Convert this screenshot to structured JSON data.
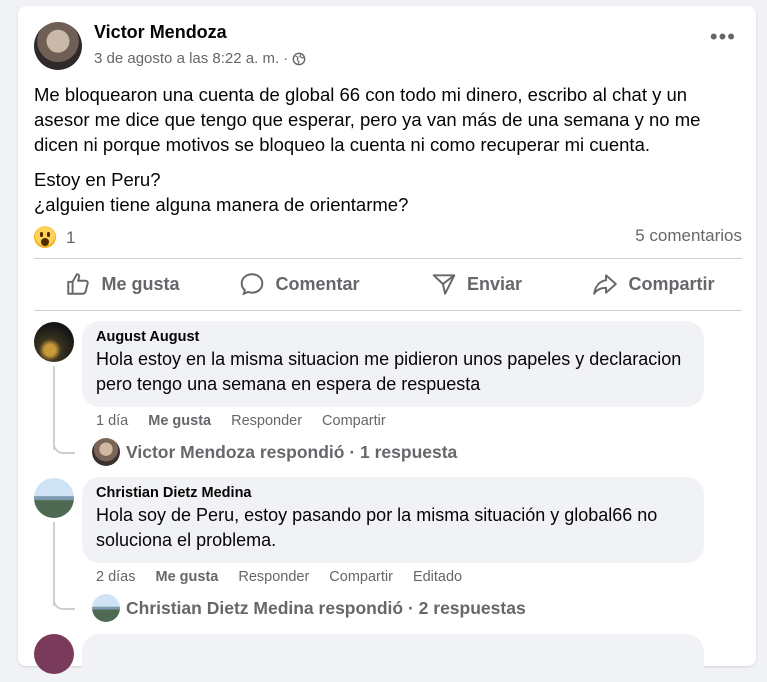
{
  "post": {
    "author": "Victor Mendoza",
    "timestamp": "3 de agosto a las 8:22 a. m. ·",
    "paragraph1": "Me bloquearon una cuenta de global 66 con todo mi dinero, escribo al chat y un asesor me dice que tengo que esperar, pero ya van más de una semana y no me dicen ni porque motivos se bloqueo la cuenta ni como recuperar mi cuenta.",
    "paragraph2_line1": "Estoy en Peru?",
    "paragraph2_line2": "¿alguien tiene alguna manera de orientarme?",
    "reaction_count": "1",
    "comments_count": "5 comentarios",
    "more_icon": "more-horizontal-icon",
    "privacy_icon": "globe-icon"
  },
  "actions": {
    "like": "Me gusta",
    "comment": "Comentar",
    "send": "Enviar",
    "share": "Compartir"
  },
  "comments": [
    {
      "name": "August August",
      "text": "Hola estoy en la misma situacion me pidieron unos papeles y declaracion pero tengo una semana en espera de respuesta",
      "time": "1 día",
      "like": "Me gusta",
      "reply": "Responder",
      "share": "Compartir",
      "replies_text": "Victor Mendoza respondió · 1 respuesta"
    },
    {
      "name": "Christian Dietz Medina",
      "text": "Hola soy de Peru, estoy pasando por la misma situación y global66 no soluciona el problema.",
      "time": "2 días",
      "like": "Me gusta",
      "reply": "Responder",
      "share": "Compartir",
      "edited": "Editado",
      "replies_text": "Christian Dietz Medina respondió · 2 respuestas"
    }
  ]
}
